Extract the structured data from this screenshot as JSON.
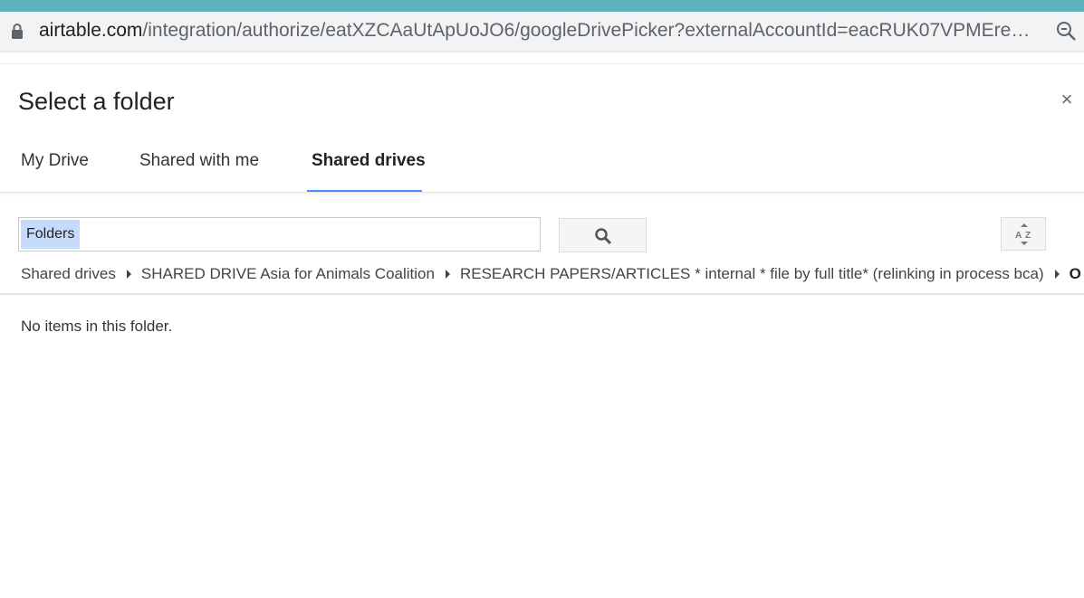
{
  "browser": {
    "url_host": "airtable.com",
    "url_path": "/integration/authorize/eatXZCAaUtApUoJO6/googleDrivePicker?externalAccountId=eacRUK07VPMEreoq..."
  },
  "dialog": {
    "title": "Select a folder",
    "close_label": "×",
    "tabs": [
      {
        "label": "My Drive"
      },
      {
        "label": "Shared with me"
      },
      {
        "label": "Shared drives"
      }
    ],
    "active_tab": "Shared drives",
    "search": {
      "chip_label": "Folders"
    },
    "breadcrumb": [
      "Shared drives",
      "SHARED DRIVE Asia for Animals Coalition",
      "RESEARCH PAPERS/ARTICLES * internal * file by full title* (relinking in process bca)",
      "O"
    ],
    "empty_message": "No items in this folder."
  },
  "colors": {
    "accent": "#4d90fe",
    "chip": "#c6dafc",
    "top_strip": "#5fb3c0"
  }
}
